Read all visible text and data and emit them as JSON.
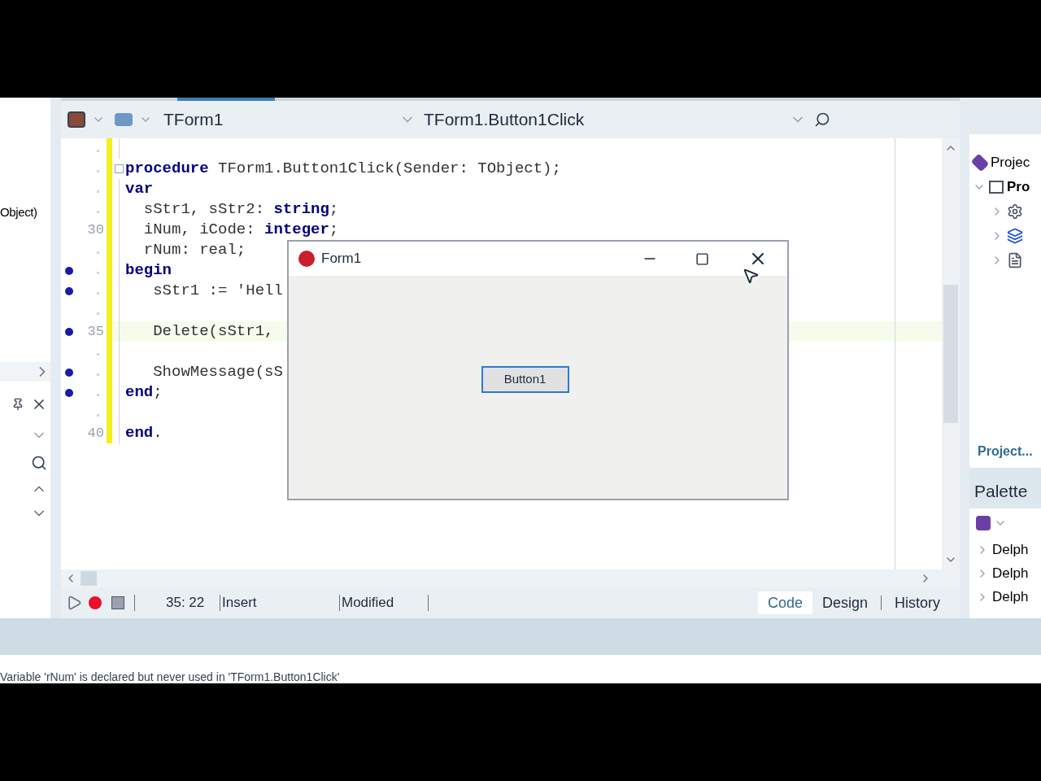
{
  "left_panel": {
    "partial_text": "Object)"
  },
  "editor": {
    "class_combo": "TForm1",
    "method_combo": "TForm1.Button1Click",
    "lines": [
      {
        "breakpoint": false,
        "current": false
      },
      {
        "code": "**procedure** TForm1.Button1Click(Sender: TObject);",
        "breakpoint": false,
        "current": false,
        "fold": true
      },
      {
        "code": "**var**",
        "breakpoint": false,
        "current": false
      },
      {
        "code": "  sStr1, sStr2: **string**;",
        "breakpoint": false,
        "current": false
      },
      {
        "number": "30",
        "code": "  iNum, iCode: **integer**;",
        "breakpoint": false,
        "current": false
      },
      {
        "code": "  rNum: real;",
        "breakpoint": false,
        "current": false
      },
      {
        "code": "**begin**",
        "breakpoint": true,
        "current": false
      },
      {
        "code": "   sStr1 := 'Hell",
        "breakpoint": true,
        "current": false
      },
      {
        "breakpoint": false,
        "current": false
      },
      {
        "number": "35",
        "code": "   Delete(sStr1,",
        "breakpoint": true,
        "current": true
      },
      {
        "breakpoint": false,
        "current": false
      },
      {
        "code": "   ShowMessage(sS",
        "breakpoint": true,
        "current": false
      },
      {
        "code": "**end**;",
        "breakpoint": true,
        "current": false
      },
      {
        "breakpoint": false,
        "current": false
      },
      {
        "number": "40",
        "code": "**end**.",
        "breakpoint": false,
        "current": false
      }
    ]
  },
  "form_window": {
    "title": "Form1",
    "button": "Button1"
  },
  "status_bar": {
    "position": "35: 22",
    "mode": "Insert",
    "state": "Modified"
  },
  "view_tabs": [
    {
      "label": "Code",
      "selected": true
    },
    {
      "label": "Design",
      "selected": false
    },
    {
      "label": "History",
      "selected": false
    }
  ],
  "project_panel": {
    "header": "Projec",
    "root": {
      "label": "Pro",
      "expanded": true,
      "children": [
        {
          "kind": "gear"
        },
        {
          "kind": "stack"
        },
        {
          "kind": "form"
        }
      ]
    },
    "link": "Project..."
  },
  "palette": {
    "title": "Palette",
    "items": [
      {
        "label": "Delph",
        "expanded": false
      },
      {
        "label": "Delph",
        "expanded": false
      },
      {
        "label": "Delph",
        "expanded": false
      }
    ]
  },
  "messages": [
    "Variable 'rNum' is declared but never used in 'TForm1.Button1Click'"
  ]
}
